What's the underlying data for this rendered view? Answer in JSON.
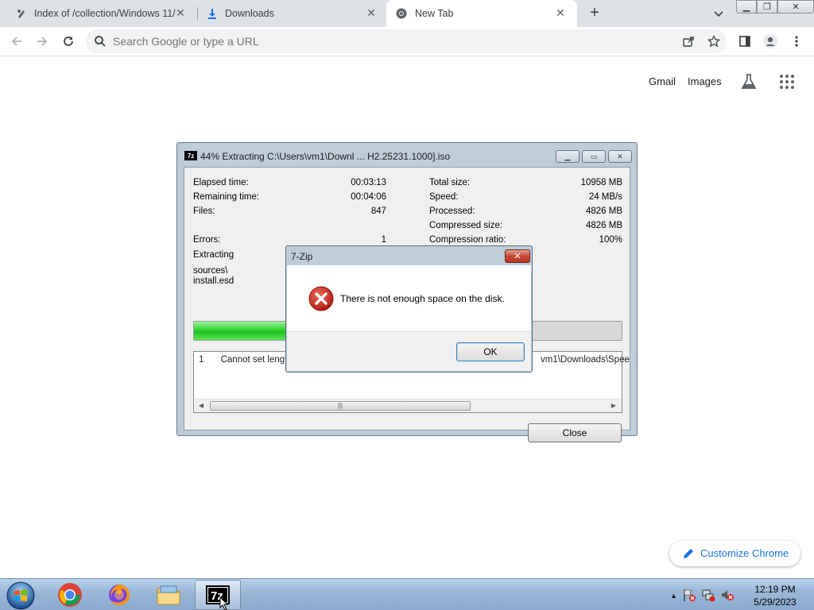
{
  "browser": {
    "tabs": [
      {
        "title": "Index of /collection/Windows 11/",
        "active": false
      },
      {
        "title": "Downloads",
        "active": false
      },
      {
        "title": "New Tab",
        "active": true
      }
    ],
    "omnibox_placeholder": "Search Google or type a URL",
    "ntp": {
      "gmail": "Gmail",
      "images": "Images"
    },
    "customize_label": "Customize Chrome",
    "colors": {
      "accent": "#1a73e8",
      "tabstrip": "#dee1e6"
    }
  },
  "progress_window": {
    "title": "44% Extracting C:\\Users\\vm1\\Downl ... H2.25231.1000].iso",
    "app_icon": "7z",
    "left_stats": [
      {
        "label": "Elapsed time:",
        "value": "00:03:13"
      },
      {
        "label": "Remaining time:",
        "value": "00:04:06"
      },
      {
        "label": "Files:",
        "value": "847"
      },
      {
        "label": "Errors:",
        "value": "1"
      }
    ],
    "right_stats": [
      {
        "label": "Total size:",
        "value": "10958 MB"
      },
      {
        "label": "Speed:",
        "value": "24 MB/s"
      },
      {
        "label": "Processed:",
        "value": "4826 MB"
      },
      {
        "label": "Compressed size:",
        "value": "4826 MB"
      },
      {
        "label": "Compression ratio:",
        "value": "100%"
      }
    ],
    "extracting_label": "Extracting",
    "current_path_line1": "sources\\",
    "current_path_line2": "install.esd",
    "progress_fraction": 0.44,
    "error_list": {
      "index": "1",
      "message_start": "Cannot set length",
      "message_end": "vm1\\Downloads\\Spee"
    },
    "close_label": "Close"
  },
  "error_dialog": {
    "title": "7-Zip",
    "message": "There is not enough space on the disk.",
    "ok_label": "OK"
  },
  "taskbar": {
    "clock_time": "12:19 PM",
    "clock_date": "5/29/2023"
  }
}
